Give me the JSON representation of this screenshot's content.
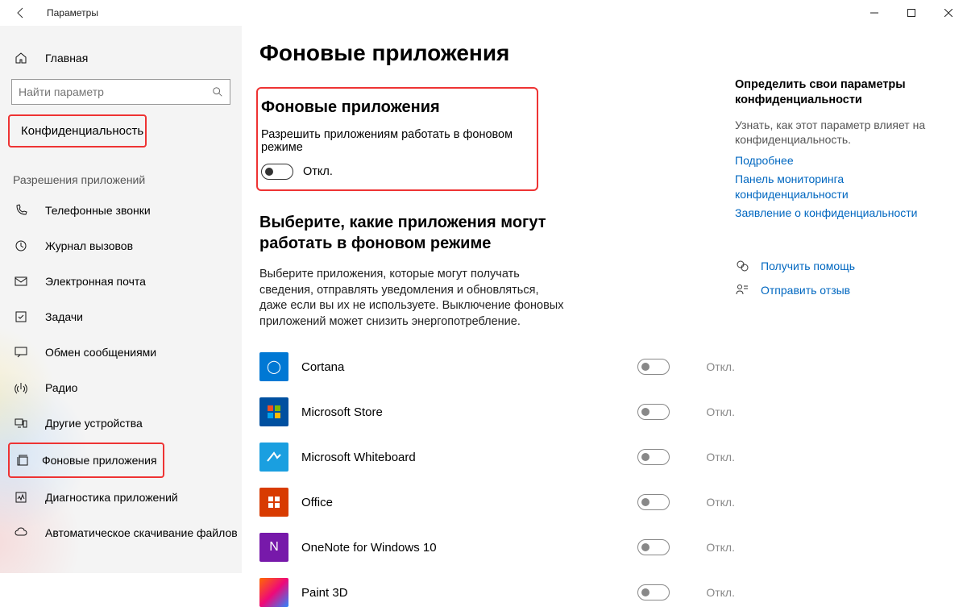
{
  "titlebar": {
    "title": "Параметры"
  },
  "sidebar": {
    "home": "Главная",
    "search_placeholder": "Найти параметр",
    "privacy_label": "Конфиденциальность",
    "group_label": "Разрешения приложений",
    "items": [
      {
        "label": "Телефонные звонки",
        "icon": "phone-icon"
      },
      {
        "label": "Журнал вызовов",
        "icon": "clock-icon"
      },
      {
        "label": "Электронная почта",
        "icon": "mail-icon"
      },
      {
        "label": "Задачи",
        "icon": "tasks-icon"
      },
      {
        "label": "Обмен сообщениями",
        "icon": "message-icon"
      },
      {
        "label": "Радио",
        "icon": "radio-icon"
      },
      {
        "label": "Другие устройства",
        "icon": "devices-icon"
      },
      {
        "label": "Фоновые приложения",
        "icon": "background-apps-icon",
        "highlight": true
      },
      {
        "label": "Диагностика приложений",
        "icon": "diagnostics-icon"
      },
      {
        "label": "Автоматическое скачивание файлов",
        "icon": "cloud-download-icon"
      }
    ]
  },
  "content": {
    "page_title": "Фоновые приложения",
    "section1_title": "Фоновые приложения",
    "master_label": "Разрешить приложениям работать в фоновом режиме",
    "master_state": "Откл.",
    "section2_title": "Выберите, какие приложения могут работать в фоновом режиме",
    "section2_desc": "Выберите приложения, которые могут получать сведения, отправлять уведомления и обновляться, даже если вы их не используете. Выключение фоновых приложений может снизить энергопотребление.",
    "off_label": "Откл.",
    "apps": [
      {
        "name": "Cortana",
        "color": "#0078d4",
        "iconText": "◯"
      },
      {
        "name": "Microsoft Store",
        "color": "#0050a0",
        "iconText": ""
      },
      {
        "name": "Microsoft Whiteboard",
        "color": "#1a9fe0",
        "iconText": ""
      },
      {
        "name": "Office",
        "color": "#d83b01",
        "iconText": ""
      },
      {
        "name": "OneNote for Windows 10",
        "color": "#7719aa",
        "iconText": "N"
      },
      {
        "name": "Paint 3D",
        "color": "linear-gradient(135deg,#ff6a00,#ee0979,#2b86ff)",
        "iconText": ""
      }
    ]
  },
  "right": {
    "heading": "Определить свои параметры конфиденциальности",
    "text": "Узнать, как этот параметр влияет на конфиденциальность.",
    "links": [
      "Подробнее",
      "Панель мониторинга конфиденциальности",
      "Заявление о конфиденциальности"
    ],
    "help": "Получить помощь",
    "feedback": "Отправить отзыв"
  }
}
